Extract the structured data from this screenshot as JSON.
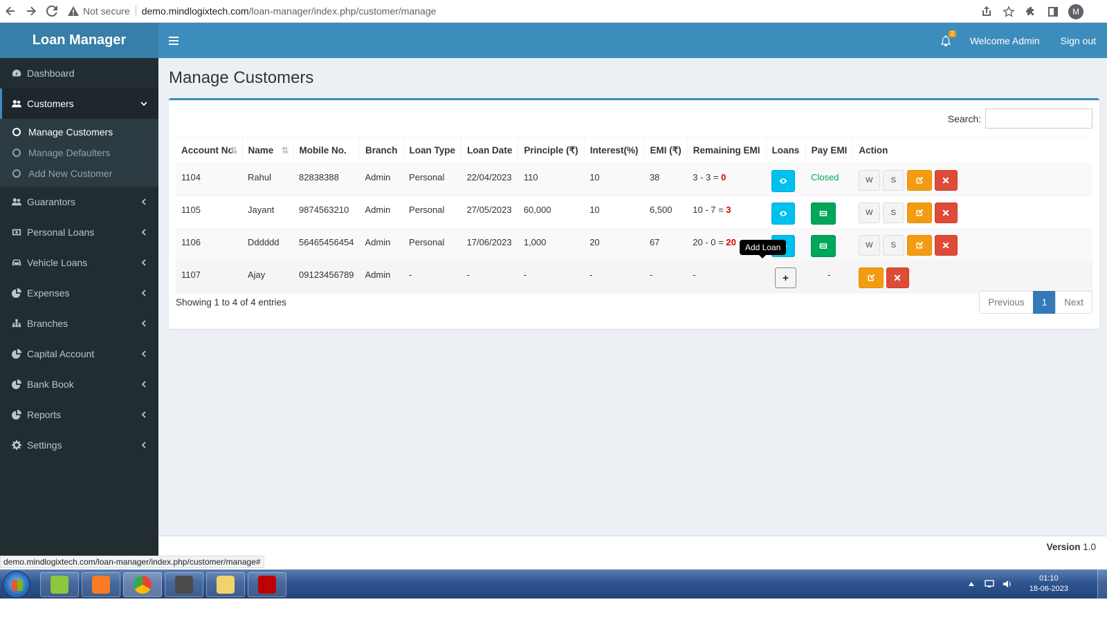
{
  "browser": {
    "security_label": "Not secure",
    "url_host": "demo.mindlogixtech.com",
    "url_path": "/loan-manager/index.php/customer/manage",
    "profile_initial": "M"
  },
  "header": {
    "app_title": "Loan Manager",
    "notification_count": "2",
    "welcome": "Welcome Admin",
    "signout": "Sign out"
  },
  "sidebar": {
    "items": [
      {
        "label": "Dashboard",
        "icon": "dashboard-icon"
      },
      {
        "label": "Customers",
        "icon": "users-icon"
      },
      {
        "label": "Guarantors",
        "icon": "users-icon"
      },
      {
        "label": "Personal Loans",
        "icon": "money-icon"
      },
      {
        "label": "Vehicle Loans",
        "icon": "car-icon"
      },
      {
        "label": "Expenses",
        "icon": "pie-chart-icon"
      },
      {
        "label": "Branches",
        "icon": "sitemap-icon"
      },
      {
        "label": "Capital Account",
        "icon": "pie-chart-icon"
      },
      {
        "label": "Bank Book",
        "icon": "pie-chart-icon"
      },
      {
        "label": "Reports",
        "icon": "pie-chart-icon"
      },
      {
        "label": "Settings",
        "icon": "gear-icon"
      }
    ],
    "customers_sub": [
      "Manage Customers",
      "Manage Defaulters",
      "Add New Customer"
    ]
  },
  "page": {
    "title": "Manage Customers",
    "search_label": "Search:",
    "search_value": ""
  },
  "table": {
    "columns": [
      "Account No.",
      "Name",
      "Mobile No.",
      "Branch",
      "Loan Type",
      "Loan Date",
      "Principle (₹)",
      "Interest(%)",
      "EMI (₹)",
      "Remaining EMI",
      "Loans",
      "Pay EMI",
      "Action"
    ],
    "rows": [
      {
        "account": "1104",
        "name": "Rahul",
        "mobile": "82838388",
        "branch": "Admin",
        "loan_type": "Personal",
        "loan_date": "22/04/2023",
        "principle": "110",
        "interest": "10",
        "emi": "38",
        "remaining_expr": "3 - 3 = ",
        "remaining": "0",
        "pay_emi": "Closed"
      },
      {
        "account": "1105",
        "name": "Jayant",
        "mobile": "9874563210",
        "branch": "Admin",
        "loan_type": "Personal",
        "loan_date": "27/05/2023",
        "principle": "60,000",
        "interest": "10",
        "emi": "6,500",
        "remaining_expr": "10 - 7 = ",
        "remaining": "3",
        "pay_emi": ""
      },
      {
        "account": "1106",
        "name": "Dddddd",
        "mobile": "56465456454",
        "branch": "Admin",
        "loan_type": "Personal",
        "loan_date": "17/06/2023",
        "principle": "1,000",
        "interest": "20",
        "emi": "67",
        "remaining_expr": "20 - 0 = ",
        "remaining": "20",
        "pay_emi": ""
      },
      {
        "account": "1107",
        "name": "Ajay",
        "mobile": "09123456789",
        "branch": "Admin",
        "loan_type": "-",
        "loan_date": "-",
        "principle": "-",
        "interest": "-",
        "emi": "-",
        "remaining_expr": "-",
        "remaining": "",
        "pay_emi": "-"
      }
    ],
    "btn_w": "W",
    "btn_s": "S",
    "add_loan_symbol": "+",
    "tooltip": "Add Loan"
  },
  "pagination": {
    "info": "Showing 1 to 4 of 4 entries",
    "previous": "Previous",
    "current": "1",
    "next": "Next"
  },
  "footer": {
    "version_label": "Version",
    "version_number": "1.0",
    "status_url": "demo.mindlogixtech.com/loan-manager/index.php/customer/manage#"
  },
  "taskbar": {
    "time": "01:10",
    "date": "18-06-2023"
  },
  "colors": {
    "header": "#3c8dbc",
    "logo_bg": "#367fa9",
    "sidebar": "#222d32",
    "info": "#00c0ef",
    "success": "#00a65a",
    "warning": "#f39c12",
    "danger": "#dd4b39"
  }
}
